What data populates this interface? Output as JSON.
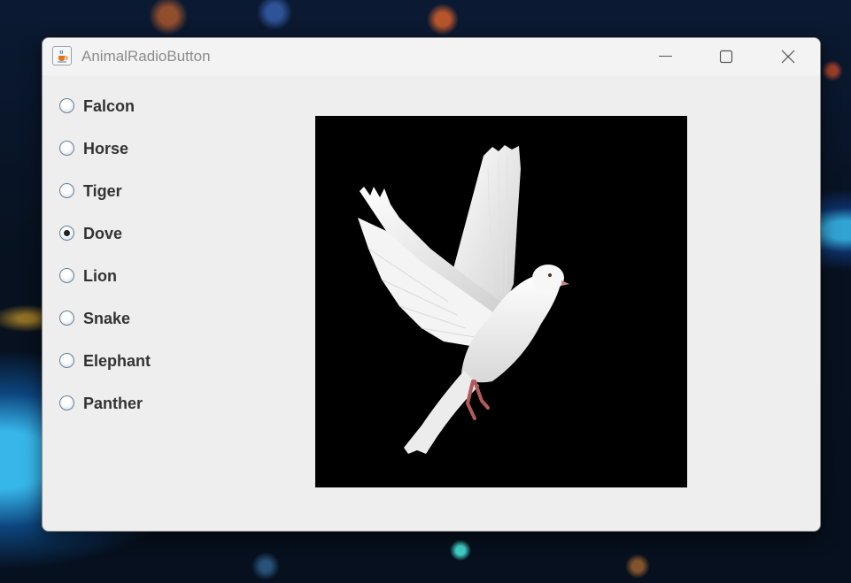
{
  "window": {
    "title": "AnimalRadioButton",
    "icon": "java-cup-icon",
    "controls": {
      "minimize": "minimize-icon",
      "maximize": "maximize-icon",
      "close": "close-icon"
    }
  },
  "radio_group": {
    "selected": "Dove",
    "options": [
      {
        "label": "Falcon",
        "checked": false
      },
      {
        "label": "Horse",
        "checked": false
      },
      {
        "label": "Tiger",
        "checked": false
      },
      {
        "label": "Dove",
        "checked": true
      },
      {
        "label": "Lion",
        "checked": false
      },
      {
        "label": "Snake",
        "checked": false
      },
      {
        "label": "Elephant",
        "checked": false
      },
      {
        "label": "Panther",
        "checked": false
      }
    ]
  },
  "image": {
    "subject": "white dove in flight on black background"
  }
}
